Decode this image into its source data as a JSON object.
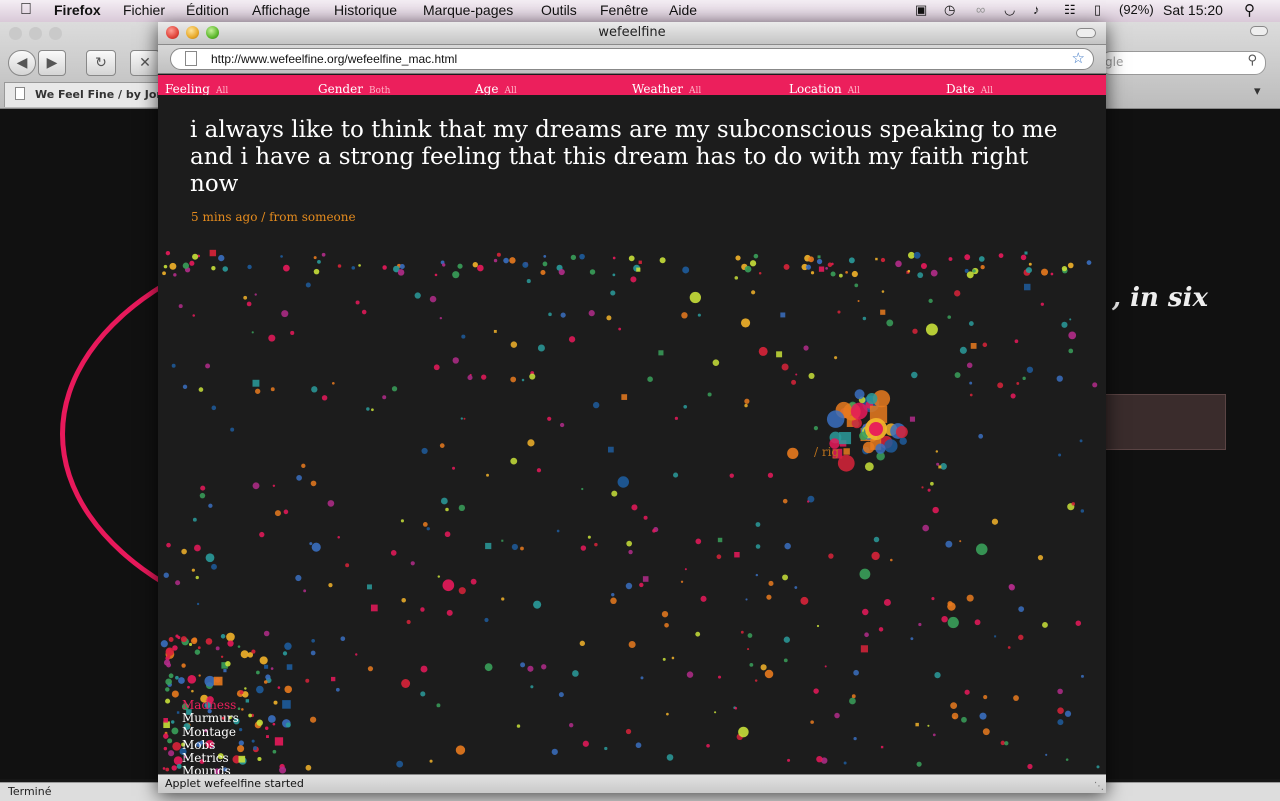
{
  "menubar": {
    "app": "Firefox",
    "items": [
      "Fichier",
      "Édition",
      "Affichage",
      "Historique",
      "Marque-pages",
      "Outils",
      "Fenêtre",
      "Aide"
    ],
    "battery": "(92%)",
    "clock": "Sat 15:20"
  },
  "background_window": {
    "tab_title": "We Feel Fine / by Jona",
    "search_placeholder": "gle",
    "headline_fragment": ", in six",
    "status": "Terminé"
  },
  "popup": {
    "title": "wefeelfine",
    "url": "http://www.wefeelfine.org/wefeelfine_mac.html",
    "status": "Applet wefeelfine started"
  },
  "filters": [
    {
      "label": "Feeling",
      "value": "All"
    },
    {
      "label": "Gender",
      "value": "Both"
    },
    {
      "label": "Age",
      "value": "All"
    },
    {
      "label": "Weather",
      "value": "All"
    },
    {
      "label": "Location",
      "value": "All"
    },
    {
      "label": "Date",
      "value": "All"
    }
  ],
  "feeling": {
    "quote": "i always like to think that my dreams are my subconscious speaking to me and i have a strong feeling that this dream has to do with my faith right now",
    "meta": "5 mins ago / from someone",
    "snippet": "/ rig"
  },
  "modes": [
    {
      "label": "Madness",
      "active": true
    },
    {
      "label": "Murmurs",
      "active": false
    },
    {
      "label": "Montage",
      "active": false
    },
    {
      "label": "Mobs",
      "active": false
    },
    {
      "label": "Metrics",
      "active": false
    },
    {
      "label": "Mounds",
      "active": false
    }
  ],
  "colors": {
    "accent": "#ec1f5c",
    "meta": "#e48b1e",
    "palette": [
      "#e8195b",
      "#e8195b",
      "#f2b32a",
      "#e87a1e",
      "#2a9b9b",
      "#1e5c9c",
      "#3aa05a",
      "#b22c8a",
      "#c8e03a",
      "#d8233a",
      "#3a6fc0"
    ]
  }
}
